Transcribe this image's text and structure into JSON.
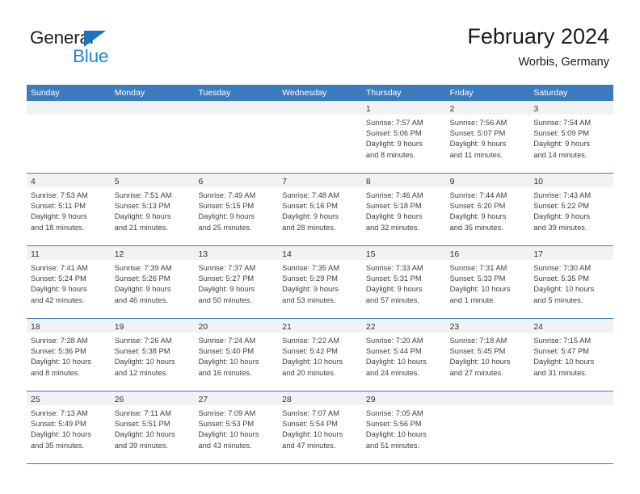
{
  "brand": {
    "name_part1": "General",
    "name_part2": "Blue",
    "accent_color": "#1b75bb",
    "blue_text_color": "#1b87d4"
  },
  "header": {
    "title": "February 2024",
    "subtitle": "Worbis, Germany"
  },
  "theme": {
    "header_blue": "#3b7cbf",
    "day_band_gray": "#f2f2f2"
  },
  "weekdays": [
    "Sunday",
    "Monday",
    "Tuesday",
    "Wednesday",
    "Thursday",
    "Friday",
    "Saturday"
  ],
  "weeks": [
    [
      {
        "day": "",
        "empty": true
      },
      {
        "day": "",
        "empty": true
      },
      {
        "day": "",
        "empty": true
      },
      {
        "day": "",
        "empty": true
      },
      {
        "day": "1",
        "sunrise": "Sunrise: 7:57 AM",
        "sunset": "Sunset: 5:06 PM",
        "daylight1": "Daylight: 9 hours",
        "daylight2": "and 8 minutes."
      },
      {
        "day": "2",
        "sunrise": "Sunrise: 7:56 AM",
        "sunset": "Sunset: 5:07 PM",
        "daylight1": "Daylight: 9 hours",
        "daylight2": "and 11 minutes."
      },
      {
        "day": "3",
        "sunrise": "Sunrise: 7:54 AM",
        "sunset": "Sunset: 5:09 PM",
        "daylight1": "Daylight: 9 hours",
        "daylight2": "and 14 minutes."
      }
    ],
    [
      {
        "day": "4",
        "sunrise": "Sunrise: 7:53 AM",
        "sunset": "Sunset: 5:11 PM",
        "daylight1": "Daylight: 9 hours",
        "daylight2": "and 18 minutes."
      },
      {
        "day": "5",
        "sunrise": "Sunrise: 7:51 AM",
        "sunset": "Sunset: 5:13 PM",
        "daylight1": "Daylight: 9 hours",
        "daylight2": "and 21 minutes."
      },
      {
        "day": "6",
        "sunrise": "Sunrise: 7:49 AM",
        "sunset": "Sunset: 5:15 PM",
        "daylight1": "Daylight: 9 hours",
        "daylight2": "and 25 minutes."
      },
      {
        "day": "7",
        "sunrise": "Sunrise: 7:48 AM",
        "sunset": "Sunset: 5:16 PM",
        "daylight1": "Daylight: 9 hours",
        "daylight2": "and 28 minutes."
      },
      {
        "day": "8",
        "sunrise": "Sunrise: 7:46 AM",
        "sunset": "Sunset: 5:18 PM",
        "daylight1": "Daylight: 9 hours",
        "daylight2": "and 32 minutes."
      },
      {
        "day": "9",
        "sunrise": "Sunrise: 7:44 AM",
        "sunset": "Sunset: 5:20 PM",
        "daylight1": "Daylight: 9 hours",
        "daylight2": "and 35 minutes."
      },
      {
        "day": "10",
        "sunrise": "Sunrise: 7:43 AM",
        "sunset": "Sunset: 5:22 PM",
        "daylight1": "Daylight: 9 hours",
        "daylight2": "and 39 minutes."
      }
    ],
    [
      {
        "day": "11",
        "sunrise": "Sunrise: 7:41 AM",
        "sunset": "Sunset: 5:24 PM",
        "daylight1": "Daylight: 9 hours",
        "daylight2": "and 42 minutes."
      },
      {
        "day": "12",
        "sunrise": "Sunrise: 7:39 AM",
        "sunset": "Sunset: 5:26 PM",
        "daylight1": "Daylight: 9 hours",
        "daylight2": "and 46 minutes."
      },
      {
        "day": "13",
        "sunrise": "Sunrise: 7:37 AM",
        "sunset": "Sunset: 5:27 PM",
        "daylight1": "Daylight: 9 hours",
        "daylight2": "and 50 minutes."
      },
      {
        "day": "14",
        "sunrise": "Sunrise: 7:35 AM",
        "sunset": "Sunset: 5:29 PM",
        "daylight1": "Daylight: 9 hours",
        "daylight2": "and 53 minutes."
      },
      {
        "day": "15",
        "sunrise": "Sunrise: 7:33 AM",
        "sunset": "Sunset: 5:31 PM",
        "daylight1": "Daylight: 9 hours",
        "daylight2": "and 57 minutes."
      },
      {
        "day": "16",
        "sunrise": "Sunrise: 7:31 AM",
        "sunset": "Sunset: 5:33 PM",
        "daylight1": "Daylight: 10 hours",
        "daylight2": "and 1 minute."
      },
      {
        "day": "17",
        "sunrise": "Sunrise: 7:30 AM",
        "sunset": "Sunset: 5:35 PM",
        "daylight1": "Daylight: 10 hours",
        "daylight2": "and 5 minutes."
      }
    ],
    [
      {
        "day": "18",
        "sunrise": "Sunrise: 7:28 AM",
        "sunset": "Sunset: 5:36 PM",
        "daylight1": "Daylight: 10 hours",
        "daylight2": "and 8 minutes."
      },
      {
        "day": "19",
        "sunrise": "Sunrise: 7:26 AM",
        "sunset": "Sunset: 5:38 PM",
        "daylight1": "Daylight: 10 hours",
        "daylight2": "and 12 minutes."
      },
      {
        "day": "20",
        "sunrise": "Sunrise: 7:24 AM",
        "sunset": "Sunset: 5:40 PM",
        "daylight1": "Daylight: 10 hours",
        "daylight2": "and 16 minutes."
      },
      {
        "day": "21",
        "sunrise": "Sunrise: 7:22 AM",
        "sunset": "Sunset: 5:42 PM",
        "daylight1": "Daylight: 10 hours",
        "daylight2": "and 20 minutes."
      },
      {
        "day": "22",
        "sunrise": "Sunrise: 7:20 AM",
        "sunset": "Sunset: 5:44 PM",
        "daylight1": "Daylight: 10 hours",
        "daylight2": "and 24 minutes."
      },
      {
        "day": "23",
        "sunrise": "Sunrise: 7:18 AM",
        "sunset": "Sunset: 5:45 PM",
        "daylight1": "Daylight: 10 hours",
        "daylight2": "and 27 minutes."
      },
      {
        "day": "24",
        "sunrise": "Sunrise: 7:15 AM",
        "sunset": "Sunset: 5:47 PM",
        "daylight1": "Daylight: 10 hours",
        "daylight2": "and 31 minutes."
      }
    ],
    [
      {
        "day": "25",
        "sunrise": "Sunrise: 7:13 AM",
        "sunset": "Sunset: 5:49 PM",
        "daylight1": "Daylight: 10 hours",
        "daylight2": "and 35 minutes."
      },
      {
        "day": "26",
        "sunrise": "Sunrise: 7:11 AM",
        "sunset": "Sunset: 5:51 PM",
        "daylight1": "Daylight: 10 hours",
        "daylight2": "and 39 minutes."
      },
      {
        "day": "27",
        "sunrise": "Sunrise: 7:09 AM",
        "sunset": "Sunset: 5:53 PM",
        "daylight1": "Daylight: 10 hours",
        "daylight2": "and 43 minutes."
      },
      {
        "day": "28",
        "sunrise": "Sunrise: 7:07 AM",
        "sunset": "Sunset: 5:54 PM",
        "daylight1": "Daylight: 10 hours",
        "daylight2": "and 47 minutes."
      },
      {
        "day": "29",
        "sunrise": "Sunrise: 7:05 AM",
        "sunset": "Sunset: 5:56 PM",
        "daylight1": "Daylight: 10 hours",
        "daylight2": "and 51 minutes."
      },
      {
        "day": "",
        "empty": true
      },
      {
        "day": "",
        "empty": true
      }
    ]
  ]
}
